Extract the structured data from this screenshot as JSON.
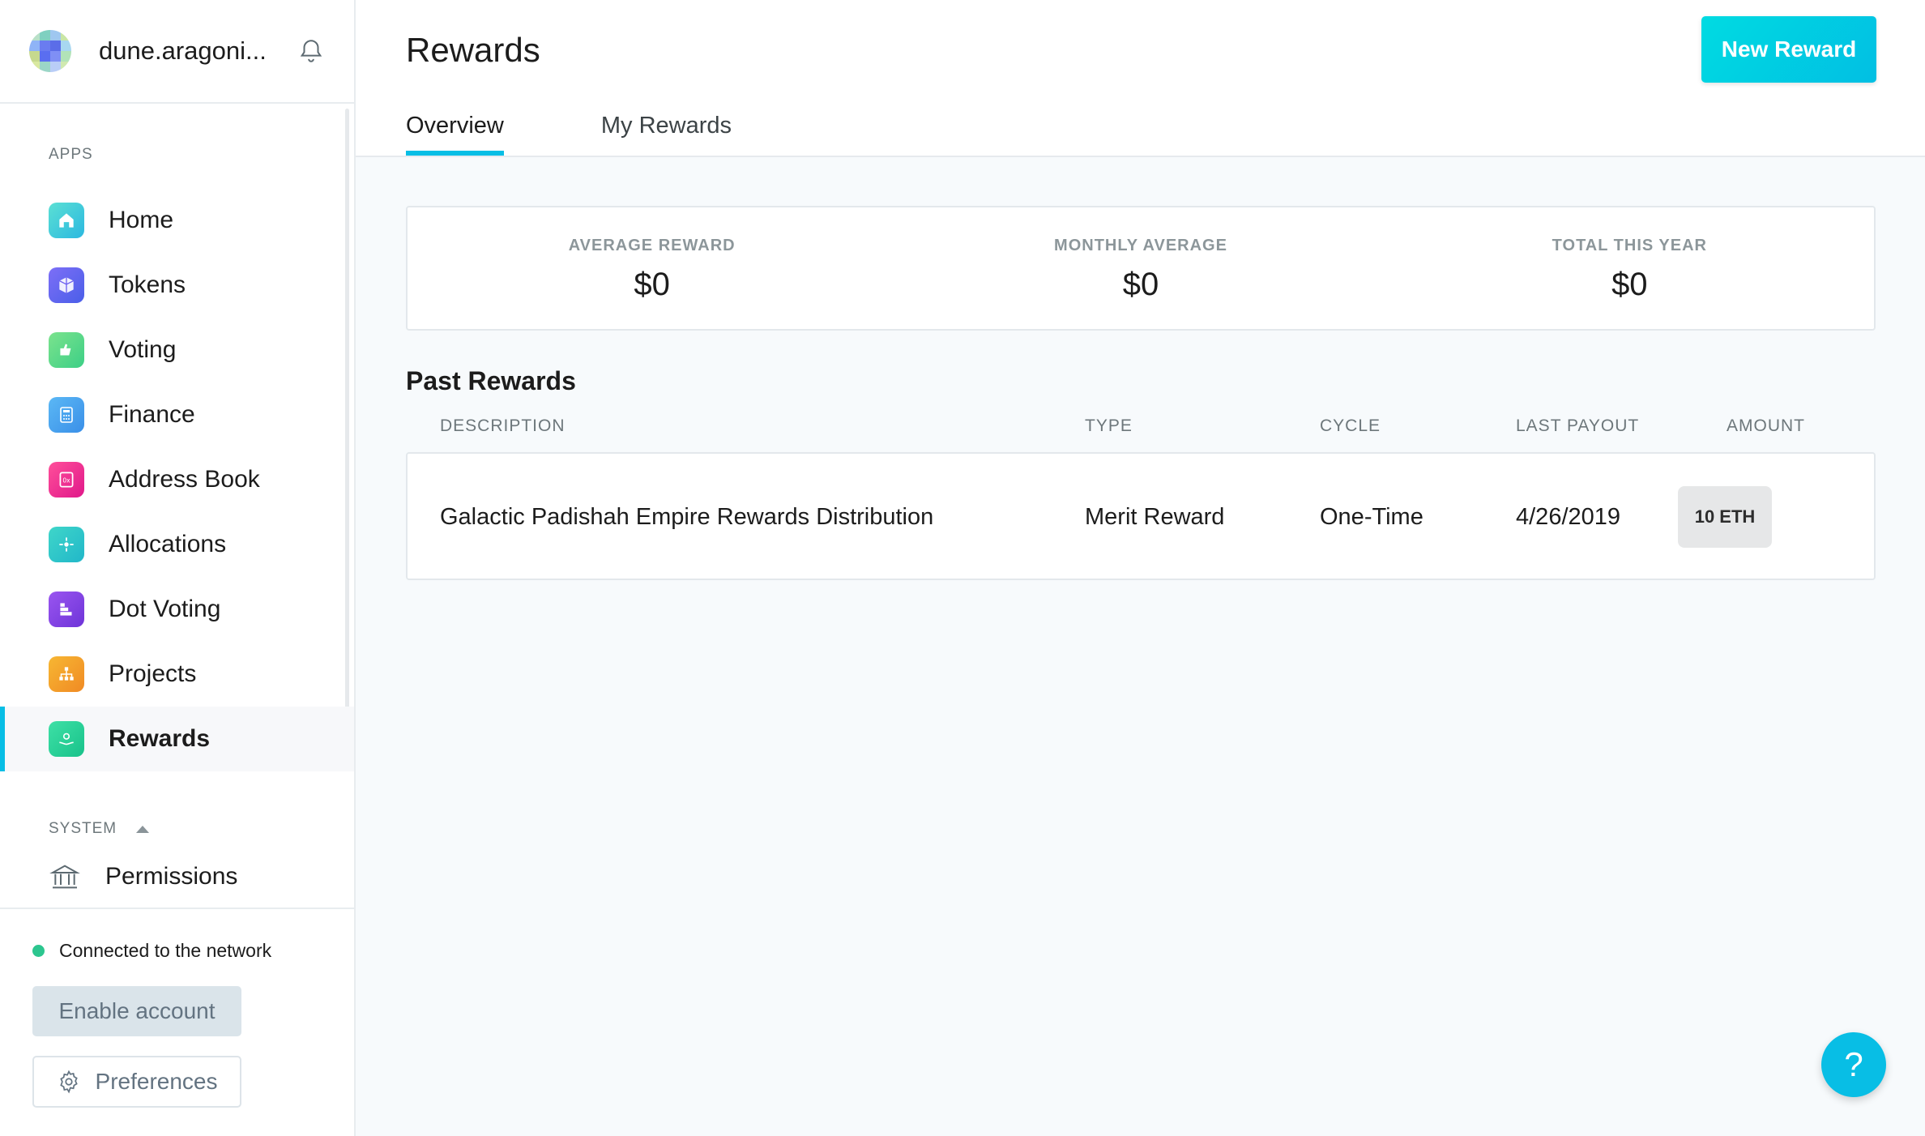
{
  "org": {
    "name": "dune.aragoni..."
  },
  "sidebar": {
    "apps_label": "APPS",
    "items": [
      {
        "label": "Home",
        "icon": "home-icon",
        "color": "#39cad6"
      },
      {
        "label": "Tokens",
        "icon": "tokens-icon",
        "color": "#6a5cf0"
      },
      {
        "label": "Voting",
        "icon": "voting-icon",
        "color": "#53d784"
      },
      {
        "label": "Finance",
        "icon": "finance-icon",
        "color": "#4aa6f0"
      },
      {
        "label": "Address Book",
        "icon": "address-book-icon",
        "color": "#f0308a"
      },
      {
        "label": "Allocations",
        "icon": "allocations-icon",
        "color": "#2dc7c7"
      },
      {
        "label": "Dot Voting",
        "icon": "dot-voting-icon",
        "color": "#8b43e0"
      },
      {
        "label": "Projects",
        "icon": "projects-icon",
        "color": "#f5a623"
      },
      {
        "label": "Rewards",
        "icon": "rewards-icon",
        "color": "#2ed19a",
        "active": true
      }
    ],
    "system_label": "SYSTEM",
    "permissions_label": "Permissions",
    "network_status": "Connected to the network",
    "enable_account": "Enable account",
    "preferences": "Preferences"
  },
  "main": {
    "title": "Rewards",
    "new_reward_button": "New Reward",
    "tabs": [
      {
        "label": "Overview",
        "active": true
      },
      {
        "label": "My Rewards",
        "active": false
      }
    ],
    "stats": [
      {
        "label": "AVERAGE REWARD",
        "value": "$0"
      },
      {
        "label": "MONTHLY AVERAGE",
        "value": "$0"
      },
      {
        "label": "TOTAL THIS YEAR",
        "value": "$0"
      }
    ],
    "past_rewards": {
      "title": "Past Rewards",
      "columns": [
        "DESCRIPTION",
        "TYPE",
        "CYCLE",
        "LAST PAYOUT",
        "AMOUNT"
      ],
      "rows": [
        {
          "description": "Galactic Padishah Empire Rewards Distribution",
          "type": "Merit Reward",
          "cycle": "One-Time",
          "last_payout": "4/26/2019",
          "amount": "10 ETH"
        }
      ]
    },
    "help": "?"
  },
  "colors": {
    "accent": "#08bee5",
    "status_ok": "#2cc68f"
  }
}
